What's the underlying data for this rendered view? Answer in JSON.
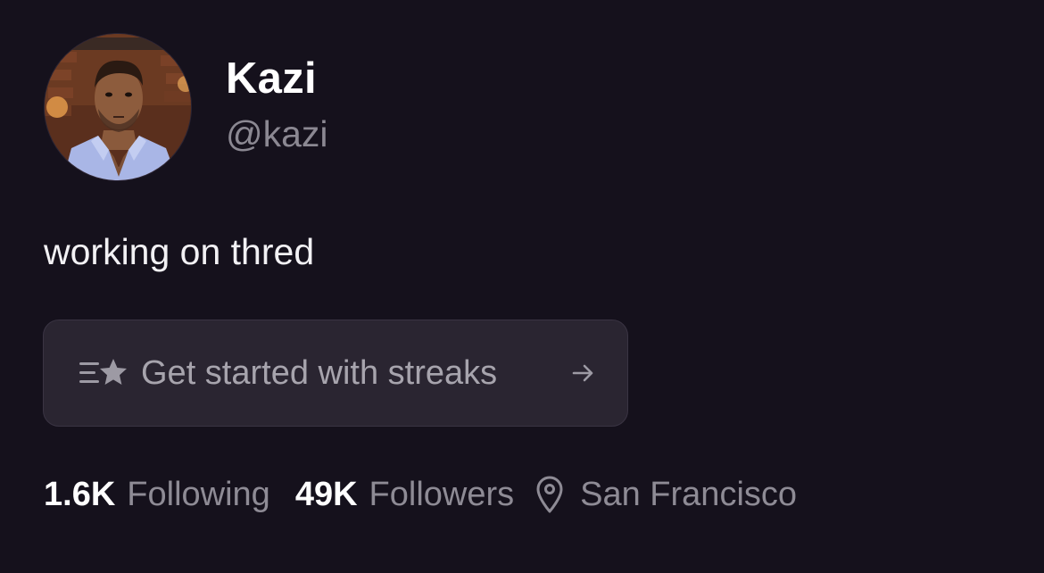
{
  "profile": {
    "display_name": "Kazi",
    "handle": "@kazi",
    "bio": "working on thred",
    "avatar_icon": "profile-photo"
  },
  "streaks_cta": {
    "label": "Get started with streaks",
    "icon": "list-star-icon",
    "arrow_icon": "arrow-right-icon"
  },
  "stats": {
    "following_count": "1.6K",
    "following_label": "Following",
    "followers_count": "49K",
    "followers_label": "Followers",
    "location_icon": "location-pin-icon",
    "location": "San Francisco"
  },
  "colors": {
    "background": "#15111c",
    "card": "#2a2531",
    "muted_text": "#8e8b95",
    "primary_text": "#ffffff"
  }
}
